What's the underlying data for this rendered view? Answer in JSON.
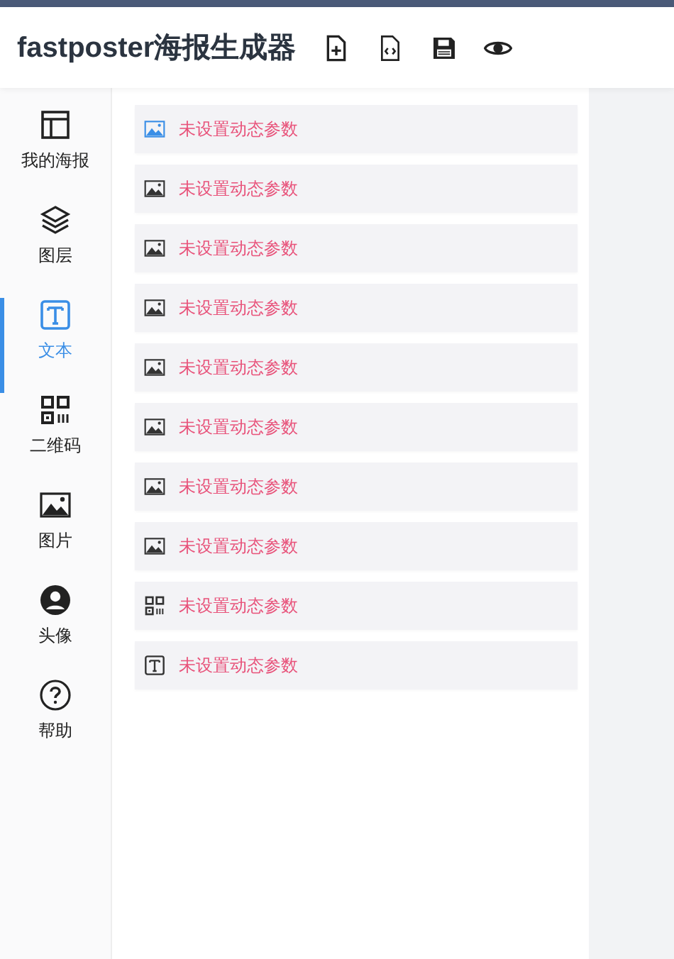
{
  "header": {
    "title": "fastposter海报生成器",
    "tools": [
      {
        "kind": "new-file"
      },
      {
        "kind": "code-file"
      },
      {
        "kind": "save"
      },
      {
        "kind": "preview"
      }
    ]
  },
  "sidebar": {
    "items": [
      {
        "label": "我的海报",
        "kind": "layout",
        "selected": false
      },
      {
        "label": "图层",
        "kind": "layers",
        "selected": false
      },
      {
        "label": "文本",
        "kind": "text",
        "selected": true
      },
      {
        "label": "二维码",
        "kind": "qr",
        "selected": false
      },
      {
        "label": "图片",
        "kind": "image",
        "selected": false
      },
      {
        "label": "头像",
        "kind": "avatar",
        "selected": false
      },
      {
        "label": "帮助",
        "kind": "help",
        "selected": false
      }
    ]
  },
  "params": [
    {
      "kind": "image",
      "label": "未设置动态参数",
      "selected": true
    },
    {
      "kind": "image",
      "label": "未设置动态参数",
      "selected": false
    },
    {
      "kind": "image",
      "label": "未设置动态参数",
      "selected": false
    },
    {
      "kind": "image",
      "label": "未设置动态参数",
      "selected": false
    },
    {
      "kind": "image",
      "label": "未设置动态参数",
      "selected": false
    },
    {
      "kind": "image",
      "label": "未设置动态参数",
      "selected": false
    },
    {
      "kind": "image",
      "label": "未设置动态参数",
      "selected": false
    },
    {
      "kind": "image",
      "label": "未设置动态参数",
      "selected": false
    },
    {
      "kind": "qr",
      "label": "未设置动态参数",
      "selected": false
    },
    {
      "kind": "text",
      "label": "未设置动态参数",
      "selected": false
    }
  ]
}
